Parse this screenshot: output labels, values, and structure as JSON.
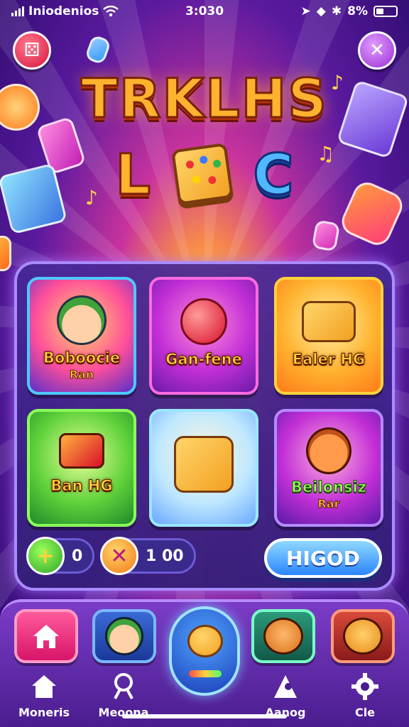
{
  "status_bar": {
    "carrier": "Iniodenios",
    "time": "3:030",
    "battery": "8%"
  },
  "header": {
    "logo_top": "TRKLHS",
    "logo_bottom_left": "L",
    "logo_bottom_right": "C"
  },
  "games": [
    {
      "title": "Boboocie",
      "subtitle": "Ran"
    },
    {
      "title": "Gan-fene",
      "subtitle": ""
    },
    {
      "title": "Ealer HG",
      "subtitle": ""
    },
    {
      "title": "Ban HG",
      "subtitle": ""
    },
    {
      "title": "",
      "subtitle": ""
    },
    {
      "title": "Beilonsiz",
      "subtitle": "Rar"
    }
  ],
  "counters": {
    "plus_value": "0",
    "coins_value": "1 00"
  },
  "play_button": "HIGOD",
  "nav": [
    {
      "label": "Moneris"
    },
    {
      "label": "Meoona"
    },
    {
      "label": "Aanog"
    },
    {
      "label": "Cle"
    }
  ],
  "colors": {
    "accent_purple": "#5a1a9e",
    "logo_orange": "#ffb22e",
    "play_blue": "#2b86ff"
  }
}
